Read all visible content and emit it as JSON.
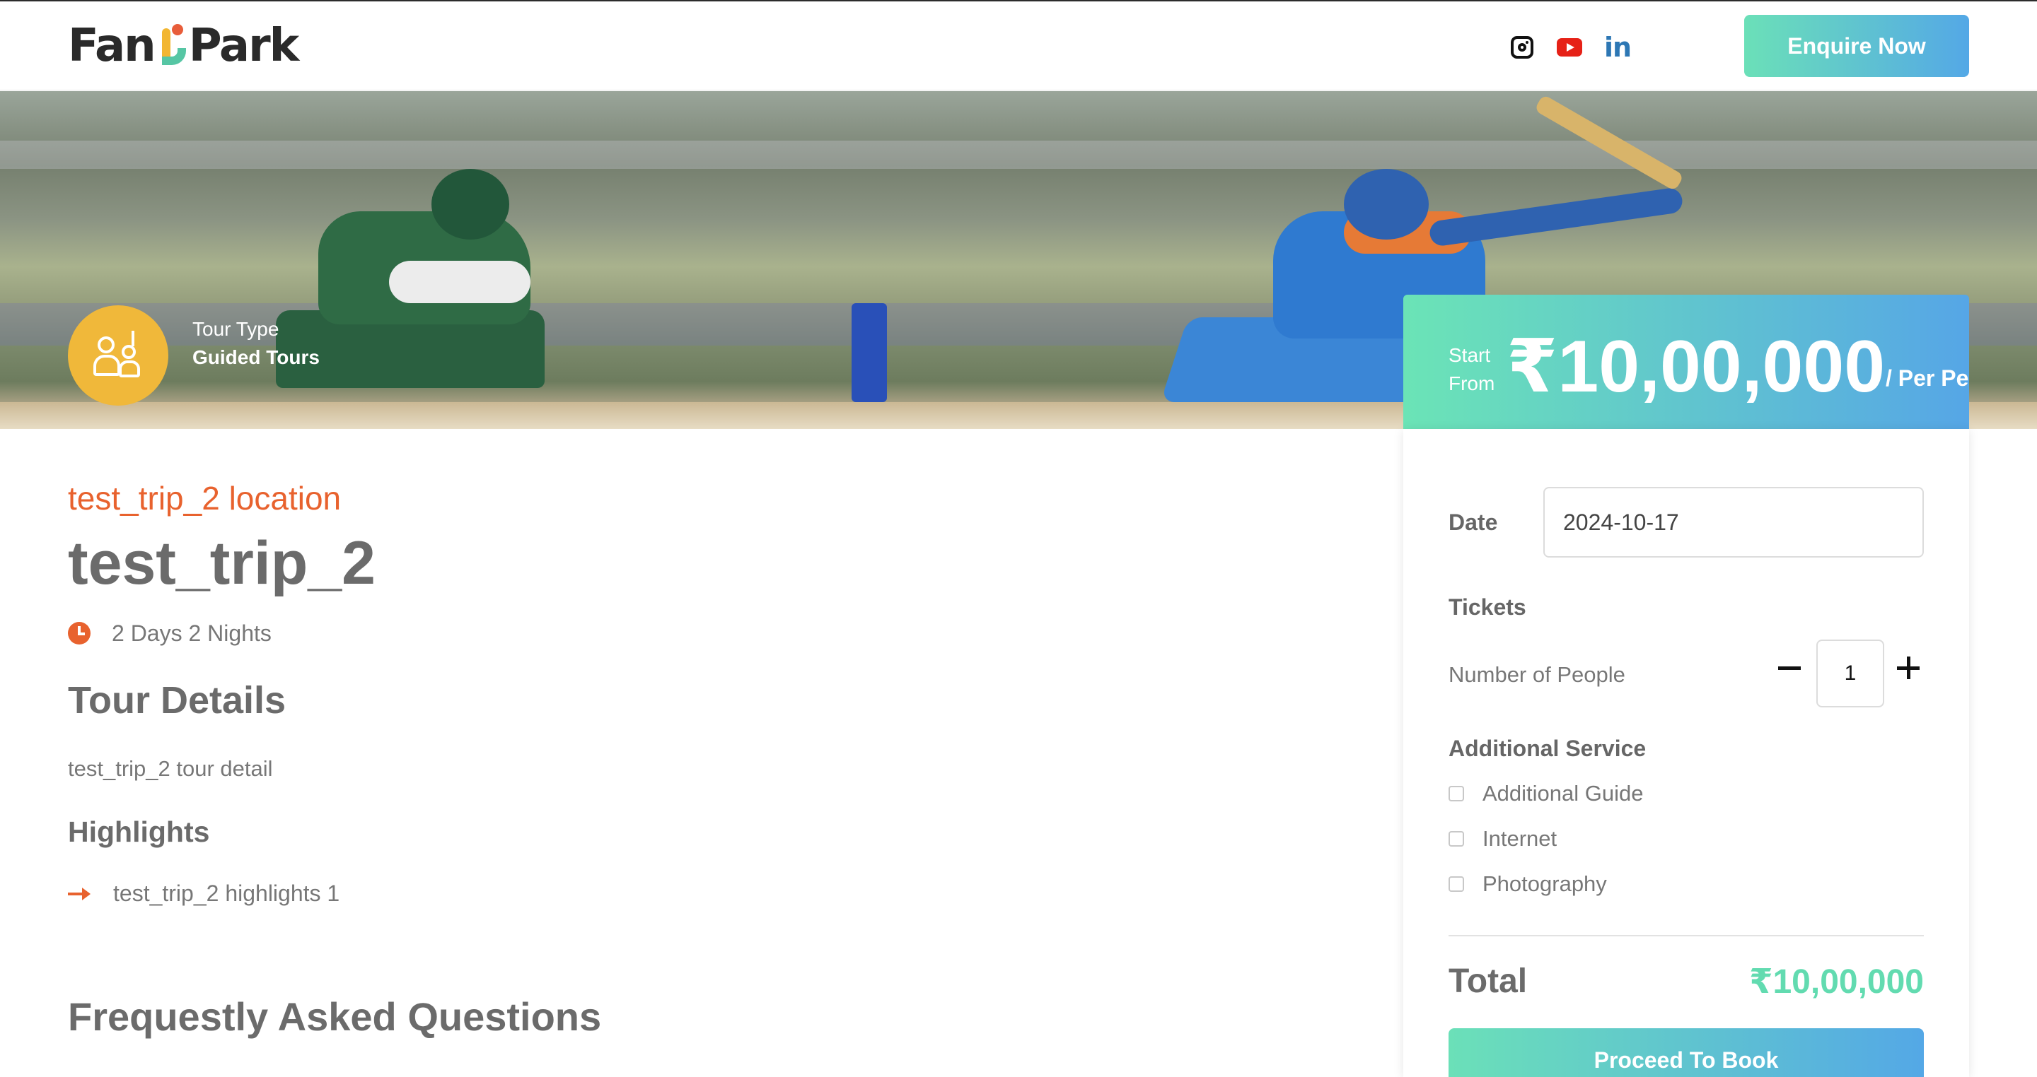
{
  "header": {
    "brand": {
      "part1": "Fan",
      "part2": "Park"
    },
    "social": [
      {
        "icon": "instagram-icon"
      },
      {
        "icon": "youtube-icon"
      },
      {
        "icon": "linkedin-icon",
        "text": "in"
      }
    ],
    "enquire_label": "Enquire Now"
  },
  "hero": {
    "tour_type_label": "Tour Type",
    "tour_type_value": "Guided Tours",
    "badge_icon": "guided-tour-icon"
  },
  "trip": {
    "location": "test_trip_2 location",
    "title": "test_trip_2",
    "duration": "2 Days 2 Nights",
    "tour_details_heading": "Tour Details",
    "tour_details_text": "test_trip_2 tour detail",
    "highlights_heading": "Highlights",
    "highlights": [
      "test_trip_2 highlights 1"
    ],
    "faq_heading": "Frequestly Asked Questions"
  },
  "booking": {
    "start_line1": "Start",
    "start_line2": "From",
    "price": "₹10,00,000",
    "per_person": "/ Per Person",
    "date_label": "Date",
    "date_value": "2024-10-17",
    "tickets_label": "Tickets",
    "people_label": "Number of People",
    "people_count": "1",
    "additional_label": "Additional Service",
    "services": [
      "Additional Guide",
      "Internet",
      "Photography"
    ],
    "total_label": "Total",
    "total_value": "₹10,00,000",
    "proceed_label": "Proceed To Book"
  },
  "colors": {
    "accent_orange": "#e8622e",
    "gradient_start": "#6be0b8",
    "gradient_end": "#54a8e6",
    "total_green": "#62dbb0",
    "badge_yellow": "#f0b83a"
  }
}
